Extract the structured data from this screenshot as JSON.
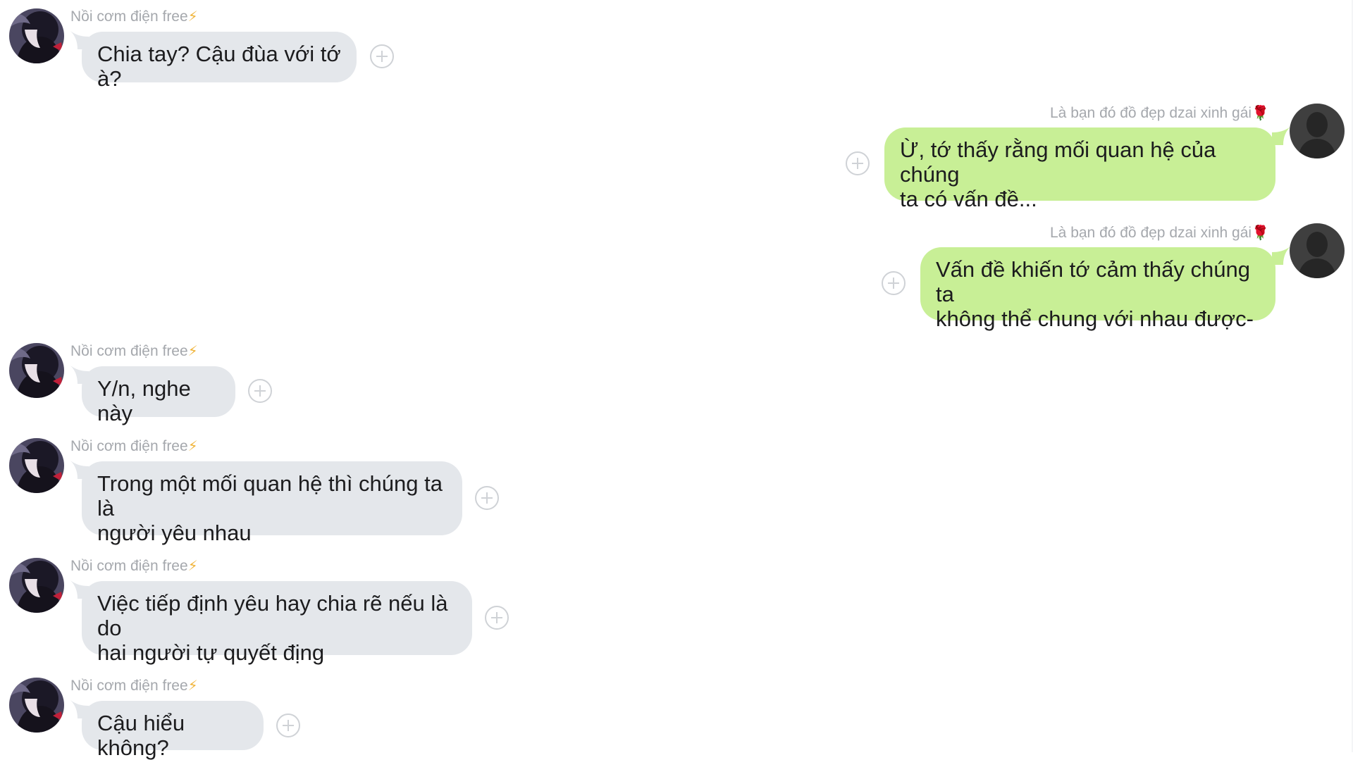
{
  "contacts": {
    "incoming": {
      "name": "Nồi cơm điện free",
      "emoji": "⚡",
      "avatar_icon": "anime-girl-avatar-icon"
    },
    "outgoing": {
      "name": "Là bạn đó đồ đẹp dzai xinh gái",
      "emoji": "🌹",
      "avatar_icon": "default-user-avatar-icon"
    }
  },
  "messages": [
    {
      "side": "in",
      "text": "Chia tay? Cậu đùa với tớ à?"
    },
    {
      "side": "out",
      "lines": [
        "Ừ, tớ thấy rằng mối quan hệ của chúng",
        "ta có vấn đề..."
      ]
    },
    {
      "side": "out",
      "lines": [
        "Vấn đề khiến tớ cảm thấy chúng ta",
        "không thể chung với nhau được-"
      ]
    },
    {
      "side": "in",
      "text": "Y/n, nghe này"
    },
    {
      "side": "in",
      "lines": [
        "Trong một mối quan hệ thì chúng ta là",
        "người yêu nhau"
      ]
    },
    {
      "side": "in",
      "lines": [
        "Việc tiếp định yêu hay chia rẽ nếu là do",
        "hai người tự quyết địng"
      ]
    },
    {
      "side": "in",
      "text": "Cậu hiểu không?"
    }
  ],
  "colors": {
    "incoming_bubble": "#e4e7eb",
    "outgoing_bubble": "#c8ef96",
    "name_text": "#a5a8ad",
    "plus_button": "#cfd2d6"
  },
  "icons": {
    "reaction_button": "plus-circle-icon",
    "bolt": "lightning-bolt-icon",
    "rose": "rose-icon"
  }
}
